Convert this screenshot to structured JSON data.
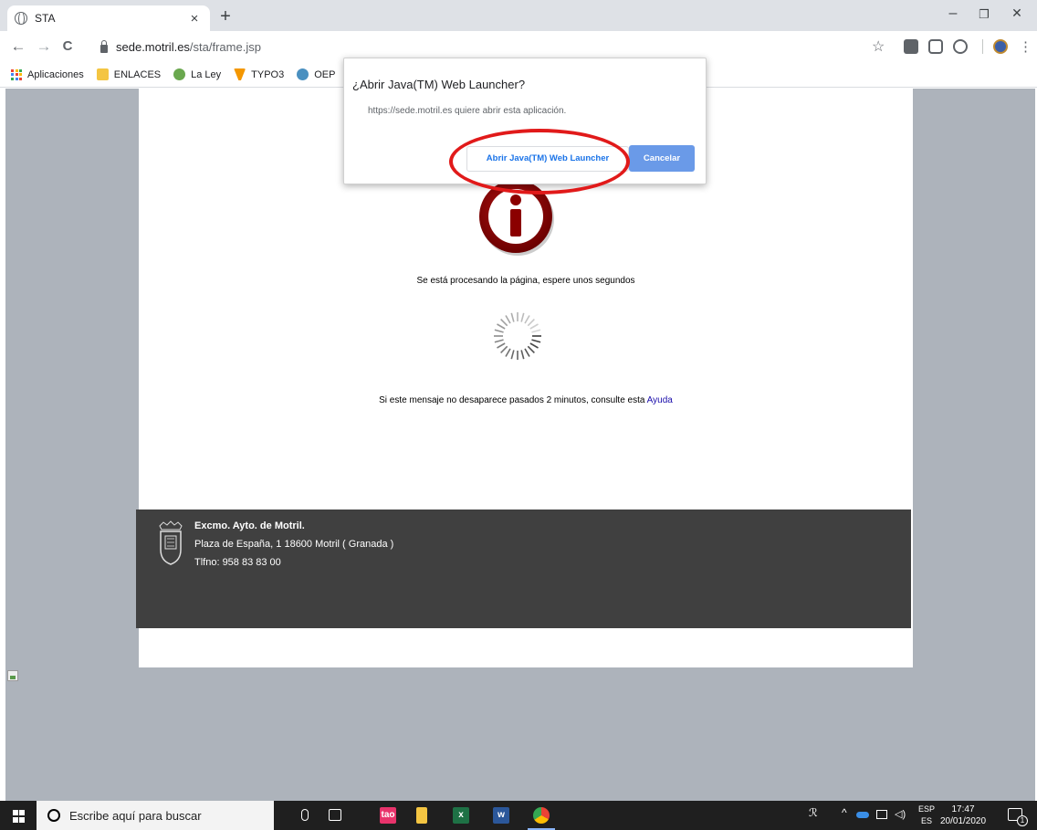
{
  "browser": {
    "tab": {
      "title": "STA",
      "close": "×",
      "new_tab": "+"
    },
    "window_controls": {
      "minimize": "–",
      "restore": "❐",
      "close": "✕"
    },
    "toolbar": {
      "back": "←",
      "forward": "→",
      "reload": "C",
      "url_host": "sede.motril.es",
      "url_path": "/sta/frame.jsp",
      "bookmark_star": "☆",
      "menu": "⋮"
    },
    "bookmarks": [
      {
        "label": "Aplicaciones",
        "icon": "apps-grid-icon"
      },
      {
        "label": "ENLACES",
        "icon": "folder-icon",
        "color": "#f4c542"
      },
      {
        "label": "La Ley",
        "icon": "la-ley-icon",
        "color": "#6aa84f"
      },
      {
        "label": "TYPO3",
        "icon": "typo3-icon",
        "color": "#f49700"
      },
      {
        "label": "OEP",
        "icon": "oep-icon",
        "color": "#4a90c0"
      }
    ]
  },
  "page": {
    "processing_message": "Se está procesando la página, espere unos segundos",
    "help_prefix": "Si este mensaje no desaparece pasados 2 minutos, consulte esta ",
    "help_link": "Ayuda",
    "footer": {
      "title": "Excmo. Ayto. de Motril.",
      "address": "Plaza de España, 1 18600 Motril ( Granada )",
      "phone": "Tlfno: 958 83 83 00"
    }
  },
  "dialog": {
    "title": "¿Abrir Java(TM) Web Launcher?",
    "body": "https://sede.motril.es quiere abrir esta aplicación.",
    "open_button": "Abrir Java(TM) Web Launcher",
    "cancel_button": "Cancelar",
    "highlight_color": "#e11a1a"
  },
  "taskbar": {
    "search_placeholder": "Escribe aquí para buscar",
    "lang_top": "ESP",
    "lang_bottom": "ES",
    "time": "17:47",
    "date": "20/01/2020",
    "notification_count": "1"
  },
  "colors": {
    "page_background": "#adb3bb",
    "footer_background": "#404040",
    "info_icon": "#8b0000",
    "accent": "#1a73e8"
  }
}
